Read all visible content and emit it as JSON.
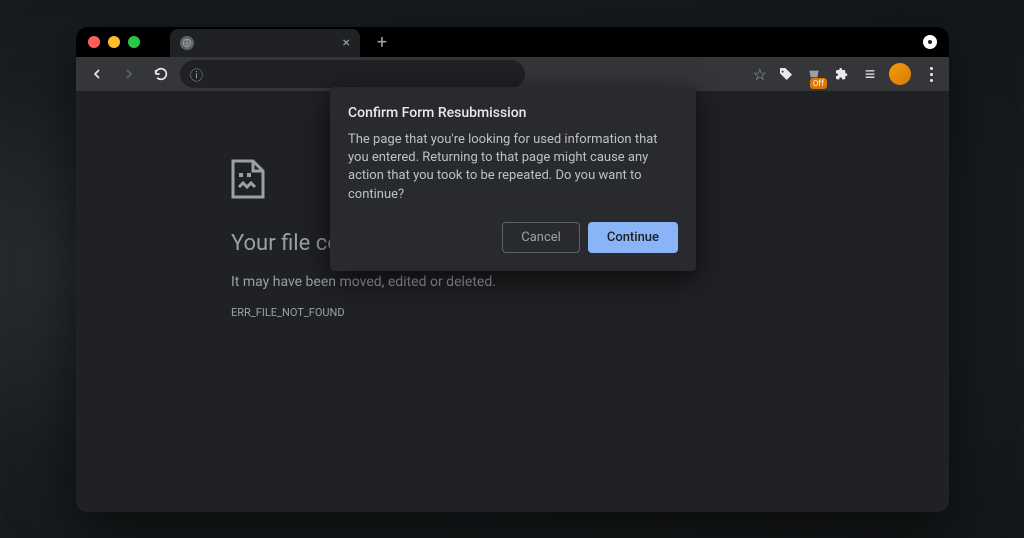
{
  "tab": {
    "close_glyph": "×"
  },
  "toolbar": {
    "new_tab_glyph": "+",
    "omnibox_info_glyph": "ⓘ",
    "url": "",
    "star_glyph": "☆",
    "off_badge": "Off",
    "reading_list_glyph": "≡"
  },
  "error_page": {
    "title": "Your file couldn't be accessed",
    "subtitle": "It may have been moved, edited or deleted.",
    "code": "ERR_FILE_NOT_FOUND"
  },
  "dialog": {
    "title": "Confirm Form Resubmission",
    "body": "The page that you're looking for used information that you entered. Returning to that page might cause any action that you took to be repeated. Do you want to continue?",
    "cancel": "Cancel",
    "continue": "Continue"
  }
}
